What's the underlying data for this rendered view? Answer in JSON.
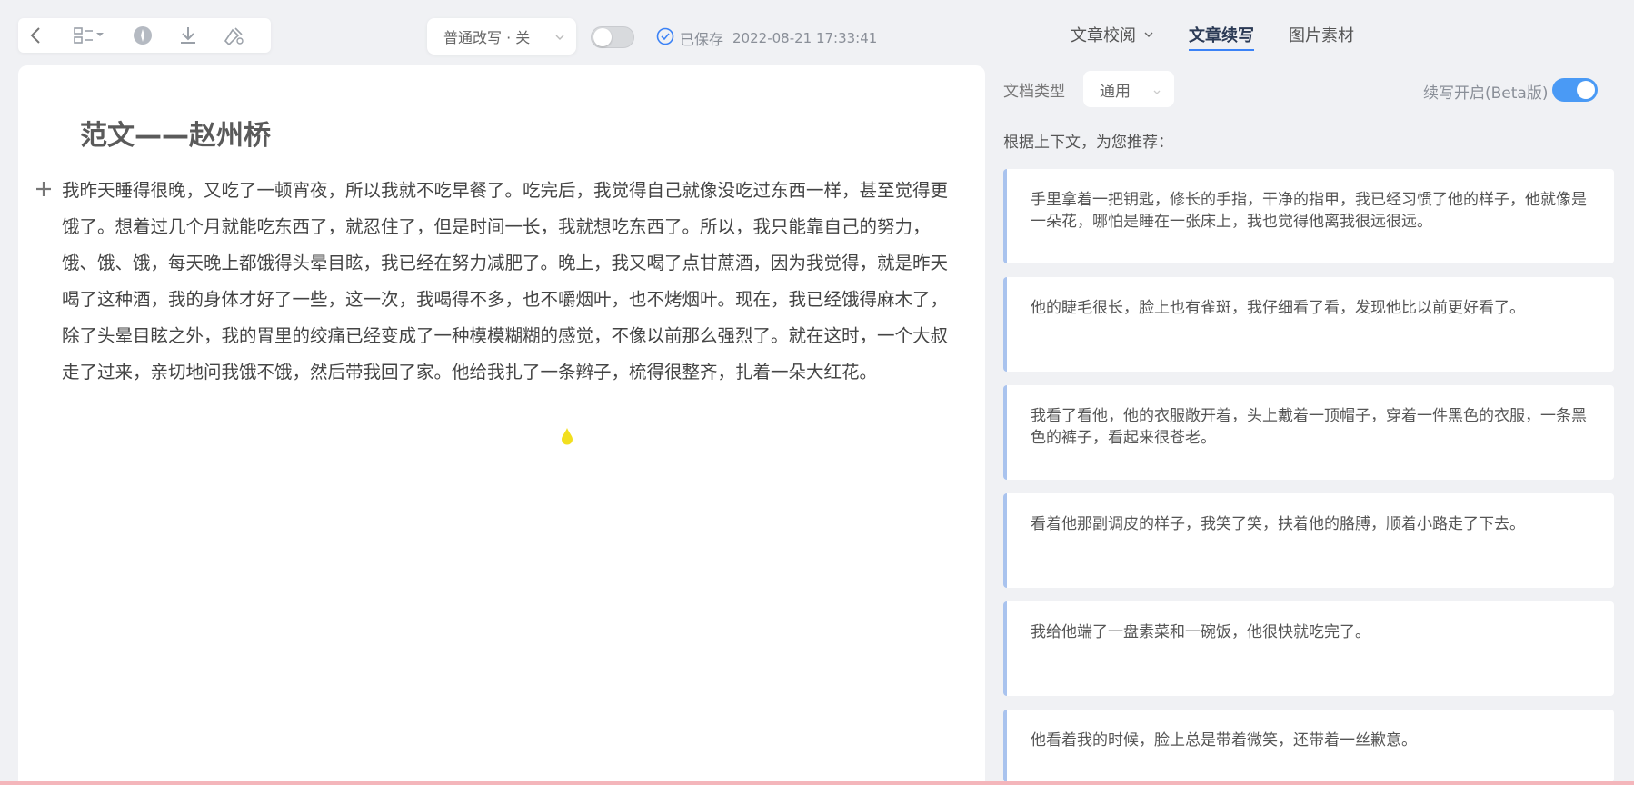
{
  "toolbar": {
    "mode_label": "普通改写 · 关",
    "saved_label": "已保存",
    "saved_time": "2022-08-21 17:33:41"
  },
  "tabs": [
    {
      "label": "文章校阅"
    },
    {
      "label": "文章续写"
    },
    {
      "label": "图片素材"
    }
  ],
  "editor": {
    "title": "范文——赵州桥",
    "body": "我昨天睡得很晚，又吃了一顿宵夜，所以我就不吃早餐了。吃完后，我觉得自己就像没吃过东西一样，甚至觉得更饿了。想着过几个月就能吃东西了，就忍住了，但是时间一长，我就想吃东西了。所以，我只能靠自己的努力，饿、饿、饿，每天晚上都饿得头晕目眩，我已经在努力减肥了。晚上，我又喝了点甘蔗酒，因为我觉得，就是昨天喝了这种酒，我的身体才好了一些，这一次，我喝得不多，也不嚼烟叶，也不烤烟叶。现在，我已经饿得麻木了，除了头晕目眩之外，我的胃里的绞痛已经变成了一种模模糊糊的感觉，不像以前那么强烈了。就在这时，一个大叔走了过来，亲切地问我饿不饿，然后带我回了家。他给我扎了一条辫子，梳得很整齐，扎着一朵大红花。"
  },
  "panel": {
    "doc_type_label": "文档类型",
    "doc_type_value": "通用",
    "continuation_label": "续写开启(Beta版)",
    "recommend_hint": "根据上下文，为您推荐：",
    "suggestions": [
      {
        "text": "手里拿着一把钥匙，修长的手指，干净的指甲，我已经习惯了他的样子，他就像是一朵花，哪怕是睡在一张床上，我也觉得他离我很远很远。"
      },
      {
        "text": "他的睫毛很长，脸上也有雀斑，我仔细看了看，发现他比以前更好看了。"
      },
      {
        "text": "我看了看他，他的衣服敞开着，头上戴着一顶帽子，穿着一件黑色的衣服，一条黑色的裤子，看起来很苍老。"
      },
      {
        "text": "看着他那副调皮的样子，我笑了笑，扶着他的胳膊，顺着小路走了下去。"
      },
      {
        "text": "我给他端了一盘素菜和一碗饭，他很快就吃完了。"
      },
      {
        "text": "他看着我的时候，脸上总是带着微笑，还带着一丝歉意。"
      }
    ]
  },
  "colors": {
    "accent": "#3b82f6",
    "toggle_on": "#4a9af5",
    "card_border": "#a9c3ee"
  },
  "icons": [
    "back-icon",
    "layout-menu-icon",
    "compass-icon",
    "download-icon",
    "brush-icon",
    "check-circle-icon",
    "chevron-down-icon",
    "plus-icon",
    "cursor-drop-icon"
  ]
}
